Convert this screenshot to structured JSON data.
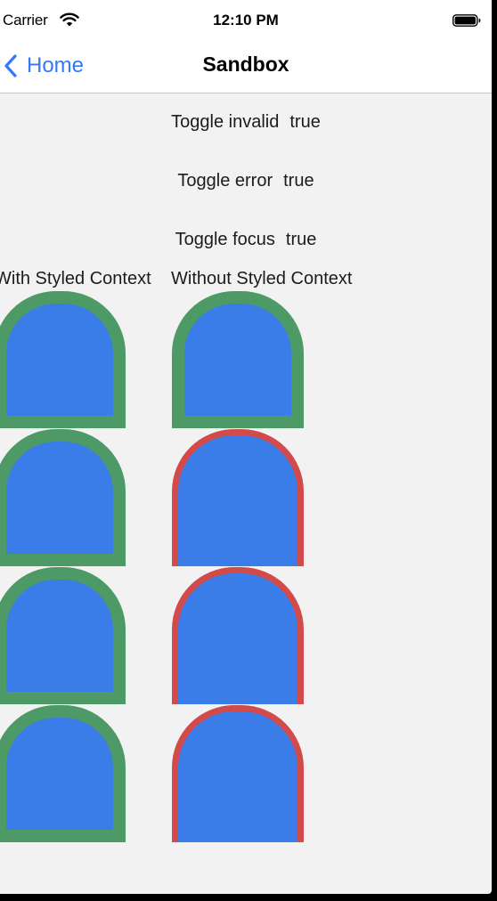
{
  "status_bar": {
    "carrier": "Carrier",
    "time": "12:10 PM",
    "wifi_icon": "wifi-icon",
    "battery_icon": "battery-full-icon"
  },
  "nav": {
    "back_label": "Home",
    "title": "Sandbox",
    "back_icon": "chevron-left-icon"
  },
  "toggles": [
    {
      "label": "Toggle invalid",
      "value": "true"
    },
    {
      "label": "Toggle error",
      "value": "true"
    },
    {
      "label": "Toggle focus",
      "value": "true"
    }
  ],
  "columns": {
    "with_styled": "With Styled Context",
    "without_styled": "Without Styled Context"
  },
  "colors": {
    "accent": "#3478f6",
    "shape_fill": "#3a7de8",
    "valid_border": "#4e9a67",
    "error_border": "#d24a4a",
    "background": "#f2f2f2"
  },
  "shape_grid": {
    "with_styled_context": [
      "green",
      "green",
      "green",
      "green"
    ],
    "without_styled_context": [
      "green",
      "red",
      "red",
      "red"
    ]
  }
}
